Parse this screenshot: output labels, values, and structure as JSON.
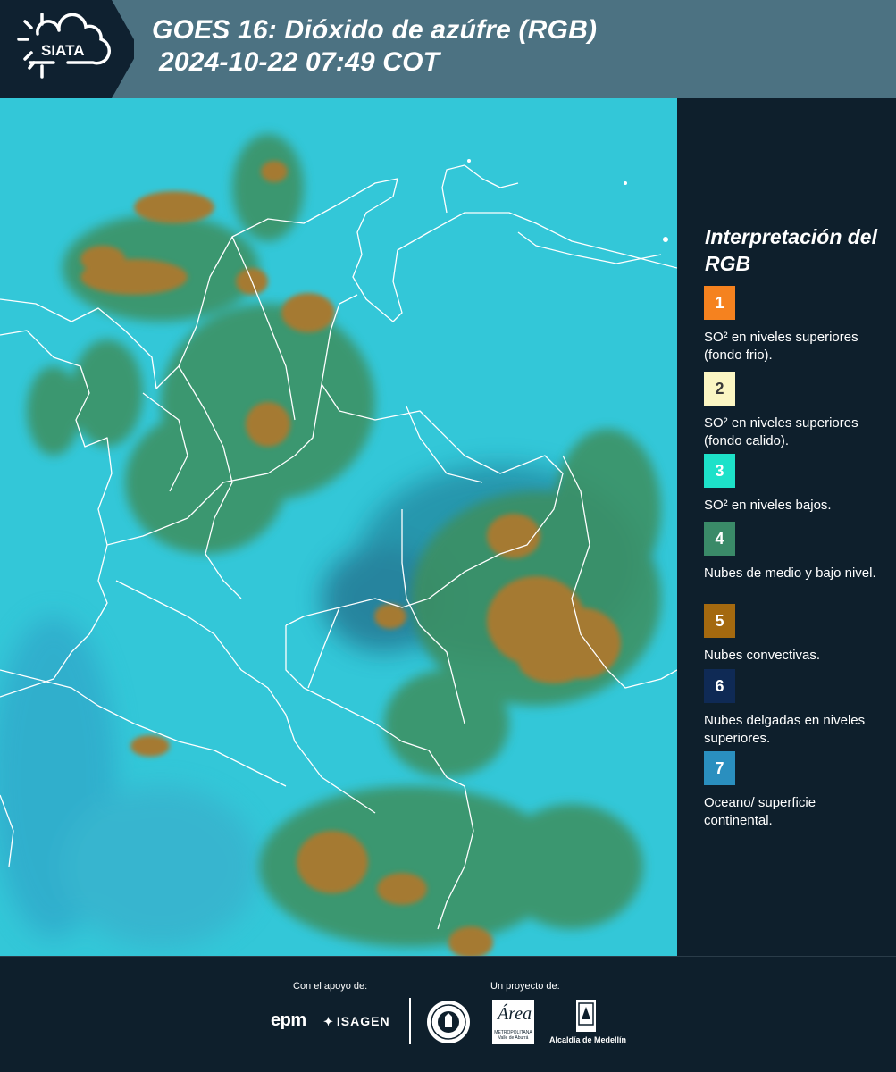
{
  "header": {
    "logo_text": "SIATA",
    "title_line1": "GOES 16: Dióxido de azúfre (RGB)",
    "title_line2": "2024-10-22 07:49 COT"
  },
  "legend": {
    "title": "Interpretación del RGB",
    "items": [
      {
        "number": "1",
        "color": "#f5821f",
        "text": "SO² en niveles superiores (fondo frio)."
      },
      {
        "number": "2",
        "color": "#fbf6c3",
        "text": "SO² en niveles superiores (fondo calido)."
      },
      {
        "number": "3",
        "color": "#1de1c9",
        "text": "SO² en niveles bajos."
      },
      {
        "number": "4",
        "color": "#3a8a68",
        "text": "Nubes de medio y bajo nivel."
      },
      {
        "number": "5",
        "color": "#a4690f",
        "text": "Nubes convectivas."
      },
      {
        "number": "6",
        "color": "#0f2a55",
        "text": "Nubes delgadas en niveles superiores."
      },
      {
        "number": "7",
        "color": "#2a8fbf",
        "text": "Oceano/ superficie continental."
      }
    ]
  },
  "footer": {
    "support_label": "Con el apoyo de:",
    "project_label": "Un proyecto de:",
    "epm": "epm",
    "isagen": "ISAGEN",
    "area_logo": "Área",
    "area_sub": "METROPOLITANA Valle de Aburrá",
    "alcaldia": "Alcaldía de Medellín"
  },
  "map": {
    "background_color": "#2fc6d6",
    "cloud_green": "#3f8f5c",
    "cloud_brown": "#a67c2e",
    "border_color": "#ffffff"
  }
}
